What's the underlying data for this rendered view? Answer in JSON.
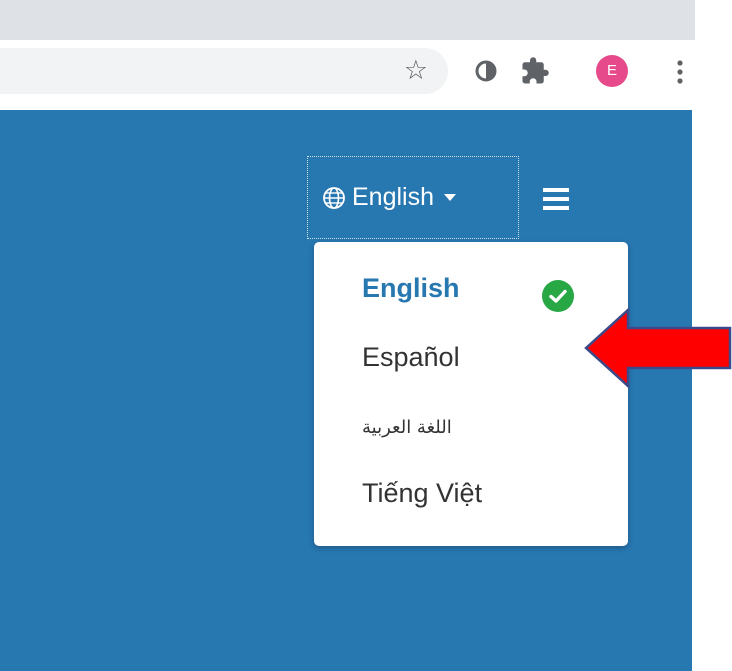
{
  "browser": {
    "bookmark_icon": "star-outline-icon",
    "extensions": [
      "circle-extension-icon",
      "puzzle-icon"
    ],
    "profile_initial": "E",
    "menu_icon": "kebab-menu-icon"
  },
  "header": {
    "language_toggle": {
      "icon": "globe-icon",
      "label": "English",
      "caret": "caret-down-icon"
    },
    "menu_icon": "hamburger-icon"
  },
  "language_menu": {
    "items": [
      {
        "label": "English",
        "selected": true
      },
      {
        "label": "Español",
        "selected": false
      },
      {
        "label": "اللغة العربية",
        "selected": false
      },
      {
        "label": "Tiếng Việt",
        "selected": false
      }
    ]
  },
  "colors": {
    "page_background": "#2777b1",
    "selected_text": "#2777b1",
    "check_badge": "#28a745",
    "annotation_arrow": "#ff0000",
    "profile_avatar": "#e64a8a"
  },
  "annotation": {
    "type": "arrow-pointing-left"
  }
}
